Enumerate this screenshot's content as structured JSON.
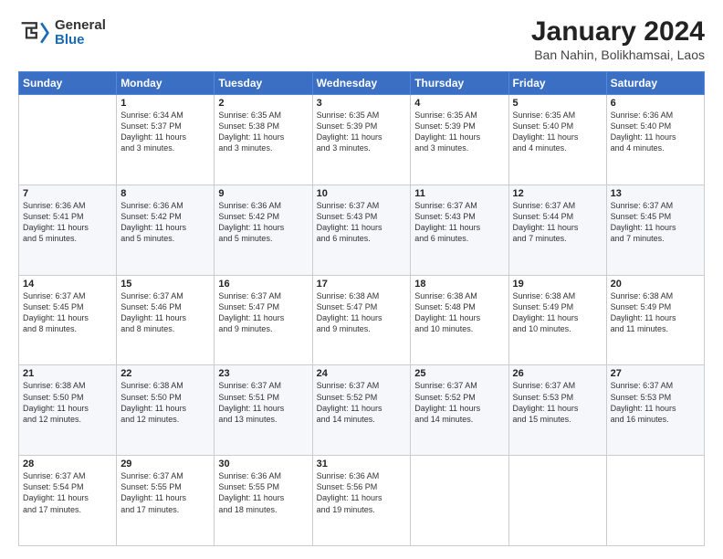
{
  "header": {
    "logo_general": "General",
    "logo_blue": "Blue",
    "month_title": "January 2024",
    "location": "Ban Nahin, Bolikhamsai, Laos"
  },
  "weekdays": [
    "Sunday",
    "Monday",
    "Tuesday",
    "Wednesday",
    "Thursday",
    "Friday",
    "Saturday"
  ],
  "weeks": [
    [
      {
        "day": "",
        "info": ""
      },
      {
        "day": "1",
        "info": "Sunrise: 6:34 AM\nSunset: 5:37 PM\nDaylight: 11 hours\nand 3 minutes."
      },
      {
        "day": "2",
        "info": "Sunrise: 6:35 AM\nSunset: 5:38 PM\nDaylight: 11 hours\nand 3 minutes."
      },
      {
        "day": "3",
        "info": "Sunrise: 6:35 AM\nSunset: 5:39 PM\nDaylight: 11 hours\nand 3 minutes."
      },
      {
        "day": "4",
        "info": "Sunrise: 6:35 AM\nSunset: 5:39 PM\nDaylight: 11 hours\nand 3 minutes."
      },
      {
        "day": "5",
        "info": "Sunrise: 6:35 AM\nSunset: 5:40 PM\nDaylight: 11 hours\nand 4 minutes."
      },
      {
        "day": "6",
        "info": "Sunrise: 6:36 AM\nSunset: 5:40 PM\nDaylight: 11 hours\nand 4 minutes."
      }
    ],
    [
      {
        "day": "7",
        "info": "Sunrise: 6:36 AM\nSunset: 5:41 PM\nDaylight: 11 hours\nand 5 minutes."
      },
      {
        "day": "8",
        "info": "Sunrise: 6:36 AM\nSunset: 5:42 PM\nDaylight: 11 hours\nand 5 minutes."
      },
      {
        "day": "9",
        "info": "Sunrise: 6:36 AM\nSunset: 5:42 PM\nDaylight: 11 hours\nand 5 minutes."
      },
      {
        "day": "10",
        "info": "Sunrise: 6:37 AM\nSunset: 5:43 PM\nDaylight: 11 hours\nand 6 minutes."
      },
      {
        "day": "11",
        "info": "Sunrise: 6:37 AM\nSunset: 5:43 PM\nDaylight: 11 hours\nand 6 minutes."
      },
      {
        "day": "12",
        "info": "Sunrise: 6:37 AM\nSunset: 5:44 PM\nDaylight: 11 hours\nand 7 minutes."
      },
      {
        "day": "13",
        "info": "Sunrise: 6:37 AM\nSunset: 5:45 PM\nDaylight: 11 hours\nand 7 minutes."
      }
    ],
    [
      {
        "day": "14",
        "info": "Sunrise: 6:37 AM\nSunset: 5:45 PM\nDaylight: 11 hours\nand 8 minutes."
      },
      {
        "day": "15",
        "info": "Sunrise: 6:37 AM\nSunset: 5:46 PM\nDaylight: 11 hours\nand 8 minutes."
      },
      {
        "day": "16",
        "info": "Sunrise: 6:37 AM\nSunset: 5:47 PM\nDaylight: 11 hours\nand 9 minutes."
      },
      {
        "day": "17",
        "info": "Sunrise: 6:38 AM\nSunset: 5:47 PM\nDaylight: 11 hours\nand 9 minutes."
      },
      {
        "day": "18",
        "info": "Sunrise: 6:38 AM\nSunset: 5:48 PM\nDaylight: 11 hours\nand 10 minutes."
      },
      {
        "day": "19",
        "info": "Sunrise: 6:38 AM\nSunset: 5:49 PM\nDaylight: 11 hours\nand 10 minutes."
      },
      {
        "day": "20",
        "info": "Sunrise: 6:38 AM\nSunset: 5:49 PM\nDaylight: 11 hours\nand 11 minutes."
      }
    ],
    [
      {
        "day": "21",
        "info": "Sunrise: 6:38 AM\nSunset: 5:50 PM\nDaylight: 11 hours\nand 12 minutes."
      },
      {
        "day": "22",
        "info": "Sunrise: 6:38 AM\nSunset: 5:50 PM\nDaylight: 11 hours\nand 12 minutes."
      },
      {
        "day": "23",
        "info": "Sunrise: 6:37 AM\nSunset: 5:51 PM\nDaylight: 11 hours\nand 13 minutes."
      },
      {
        "day": "24",
        "info": "Sunrise: 6:37 AM\nSunset: 5:52 PM\nDaylight: 11 hours\nand 14 minutes."
      },
      {
        "day": "25",
        "info": "Sunrise: 6:37 AM\nSunset: 5:52 PM\nDaylight: 11 hours\nand 14 minutes."
      },
      {
        "day": "26",
        "info": "Sunrise: 6:37 AM\nSunset: 5:53 PM\nDaylight: 11 hours\nand 15 minutes."
      },
      {
        "day": "27",
        "info": "Sunrise: 6:37 AM\nSunset: 5:53 PM\nDaylight: 11 hours\nand 16 minutes."
      }
    ],
    [
      {
        "day": "28",
        "info": "Sunrise: 6:37 AM\nSunset: 5:54 PM\nDaylight: 11 hours\nand 17 minutes."
      },
      {
        "day": "29",
        "info": "Sunrise: 6:37 AM\nSunset: 5:55 PM\nDaylight: 11 hours\nand 17 minutes."
      },
      {
        "day": "30",
        "info": "Sunrise: 6:36 AM\nSunset: 5:55 PM\nDaylight: 11 hours\nand 18 minutes."
      },
      {
        "day": "31",
        "info": "Sunrise: 6:36 AM\nSunset: 5:56 PM\nDaylight: 11 hours\nand 19 minutes."
      },
      {
        "day": "",
        "info": ""
      },
      {
        "day": "",
        "info": ""
      },
      {
        "day": "",
        "info": ""
      }
    ]
  ]
}
